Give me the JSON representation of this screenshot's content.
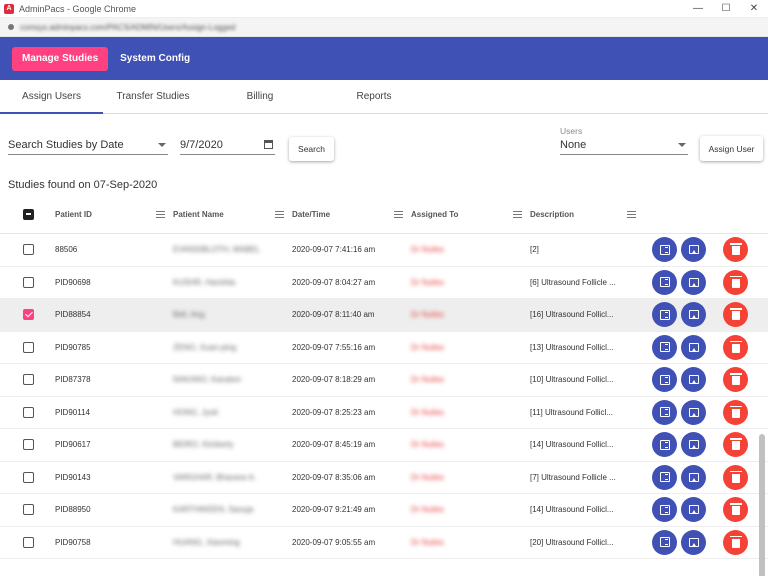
{
  "window": {
    "title": "AdminPacs - Google Chrome",
    "url": "comsys.adminpacs.com/PACS/ADMIN/Users/Assign-Logged",
    "controls": [
      "—",
      "☐",
      "✕"
    ]
  },
  "nav": {
    "items": [
      {
        "label": "Manage Studies",
        "active": true
      },
      {
        "label": "System Config",
        "active": false
      }
    ]
  },
  "tabs": [
    {
      "label": "Assign Users",
      "active": true
    },
    {
      "label": "Transfer Studies",
      "active": false
    },
    {
      "label": "Billing",
      "active": false
    },
    {
      "label": "Reports",
      "active": false
    }
  ],
  "filters": {
    "search_by": "Search Studies by Date",
    "date": "9/7/2020",
    "search_label": "Search",
    "users_label": "Users",
    "users_value": "None",
    "assign_label": "Assign User"
  },
  "found_text": "Studies found on 07-Sep-2020",
  "table": {
    "headers": [
      "Patient ID",
      "Patient Name",
      "Date/Time",
      "Assigned To",
      "Description"
    ],
    "rows": [
      {
        "id": "88506",
        "name": "EVANS/BLOTH, MABEL",
        "datetime": "2020-09-07 7:41:16 am",
        "assigned": "Dr Nuiles",
        "desc": "[2]",
        "checked": false
      },
      {
        "id": "PID90698",
        "name": "KUSHR, Harshita",
        "datetime": "2020-09-07 8:04:27 am",
        "assigned": "Dr Nuiles",
        "desc": "[6] Ultrasound Follicle ...",
        "checked": false
      },
      {
        "id": "PID88854",
        "name": "Bell, Ang",
        "datetime": "2020-09-07 8:11:40 am",
        "assigned": "Dr Nuiles",
        "desc": "[16] Ultrasound Follicl...",
        "checked": true
      },
      {
        "id": "PID90785",
        "name": "ZENO, Xuan-ping",
        "datetime": "2020-09-07 7:55:16 am",
        "assigned": "Dr Nuiles",
        "desc": "[13] Ultrasound Follicl...",
        "checked": false
      },
      {
        "id": "PID87378",
        "name": "NAKANO, Kanaton",
        "datetime": "2020-09-07 8:18:29 am",
        "assigned": "Dr Nuiles",
        "desc": "[10] Ultrasound Follicl...",
        "checked": false
      },
      {
        "id": "PID90114",
        "name": "HONG, Jyoti",
        "datetime": "2020-09-07 8:25:23 am",
        "assigned": "Dr Nuiles",
        "desc": "[11] Ultrasound Follicl...",
        "checked": false
      },
      {
        "id": "PID90617",
        "name": "BEIRO, Kimberly",
        "datetime": "2020-09-07 8:45:19 am",
        "assigned": "Dr Nuiles",
        "desc": "[14] Ultrasound Follicl...",
        "checked": false
      },
      {
        "id": "PID90143",
        "name": "VARGHAR, Bharane A.",
        "datetime": "2020-09-07 8:35:06 am",
        "assigned": "Dr Nuiles",
        "desc": "[7] Ultrasound Follicle ...",
        "checked": false
      },
      {
        "id": "PID88950",
        "name": "KARTHIKEEN, Sanuja",
        "datetime": "2020-09-07 9:21:49 am",
        "assigned": "Dr Nuiles",
        "desc": "[14] Ultrasound Follicl...",
        "checked": false
      },
      {
        "id": "PID90758",
        "name": "HUANG, Xianming",
        "datetime": "2020-09-07 9:05:55 am",
        "assigned": "Dr Nuiles",
        "desc": "[20] Ultrasound Follicl...",
        "checked": false
      }
    ]
  },
  "colors": {
    "primary": "#3f51b5",
    "accent": "#ff4081",
    "danger": "#f44336"
  }
}
